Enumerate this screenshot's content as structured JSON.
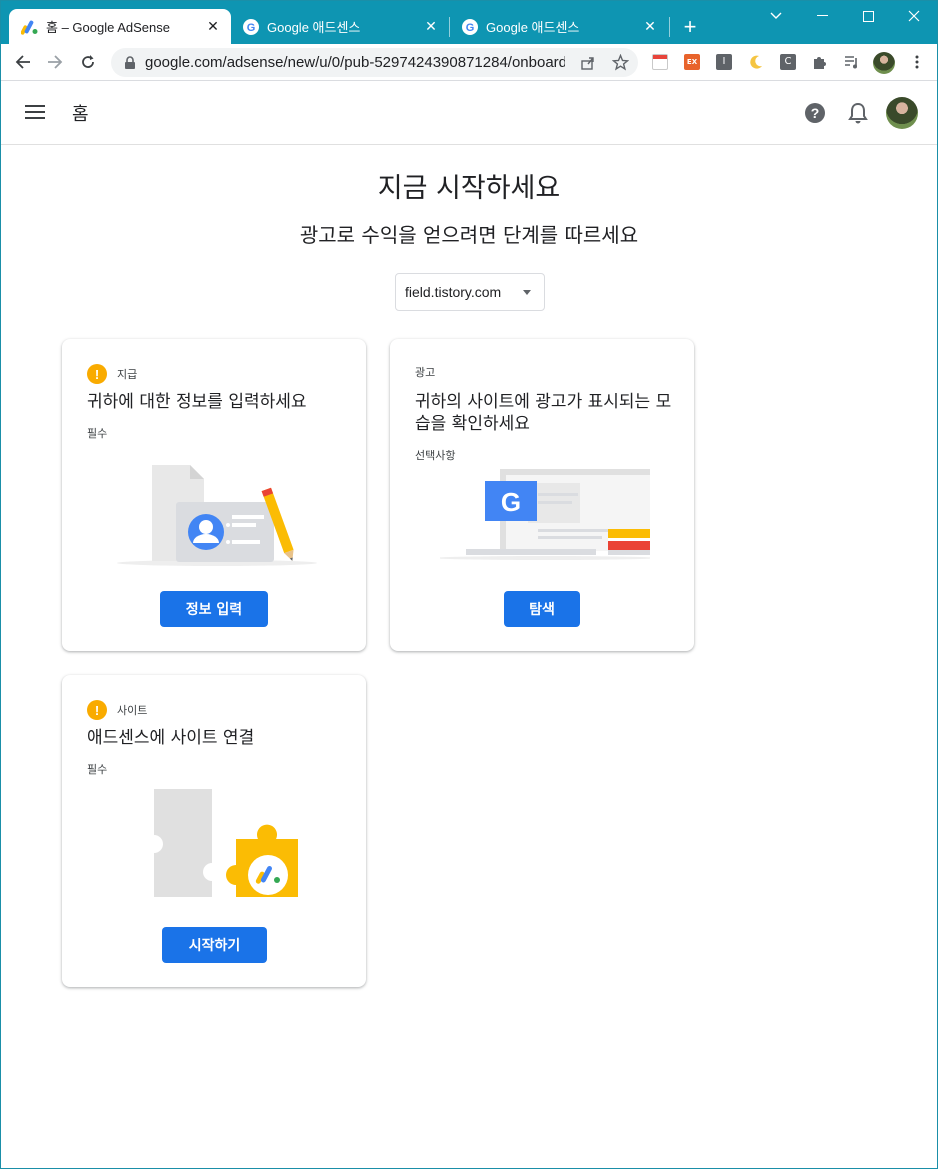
{
  "browser": {
    "tabs": [
      {
        "title": "홈 – Google AdSense",
        "active": true
      },
      {
        "title": "Google 애드센스",
        "active": false
      },
      {
        "title": "Google 애드센스",
        "active": false
      }
    ],
    "new_tab_label": "+",
    "url": "google.com/adsense/new/u/0/pub-5297424390871284/onboardi..."
  },
  "app": {
    "title": "홈"
  },
  "main": {
    "headline": "지금 시작하세요",
    "subhead": "광고로 수익을 얻으려면 단계를 따르세요",
    "site_select": "field.tistory.com"
  },
  "cards": [
    {
      "category": "지급",
      "title": "귀하에 대한 정보를 입력하세요",
      "requirement": "필수",
      "button": "정보 입력",
      "warning": true
    },
    {
      "category": "광고",
      "title": "귀하의 사이트에 광고가 표시되는 모습을 확인하세요",
      "requirement": "선택사항",
      "button": "탐색",
      "warning": false
    },
    {
      "category": "사이트",
      "title": "애드센스에 사이트 연결",
      "requirement": "필수",
      "button": "시작하기",
      "warning": true
    }
  ],
  "colors": {
    "titlebar": "#0e95b2",
    "primary_button": "#1a73e8",
    "warning": "#f9ab00"
  },
  "icons": {
    "warning": "exclamation-icon",
    "help": "help-circle-icon",
    "notifications": "bell-icon"
  }
}
